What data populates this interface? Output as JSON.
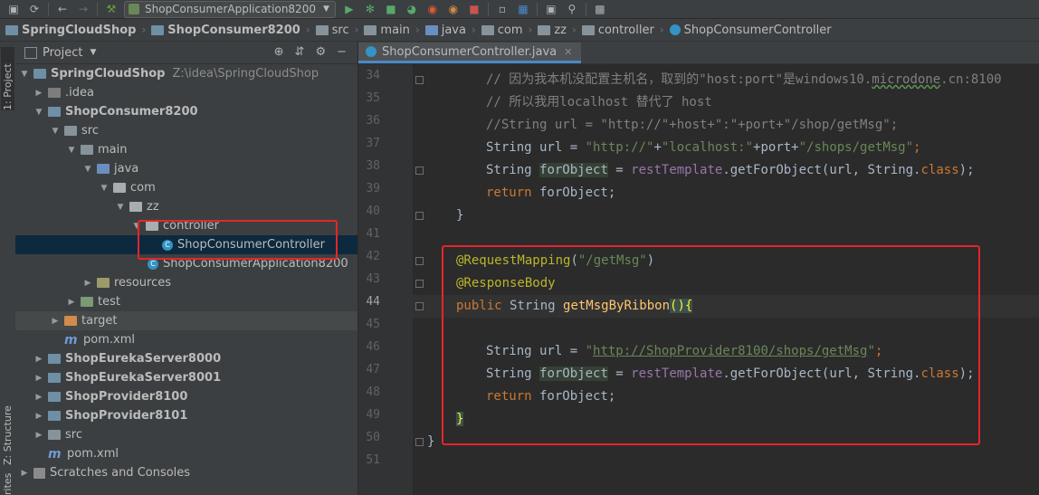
{
  "toolbar": {
    "icons": [
      "save-icon",
      "sync-icon",
      "back-icon",
      "forward-icon",
      "build-icon"
    ],
    "run_config_label": "ShopConsumerApplication8200",
    "run_icons": [
      "run-icon",
      "debug-icon",
      "coverage-icon",
      "profile-icon",
      "stop-icon",
      "vcs-icon",
      "structure-icon",
      "layout-icon",
      "search-icon",
      "plugin-icon"
    ]
  },
  "breadcrumb": [
    "SpringCloudShop",
    "ShopConsumer8200",
    "src",
    "main",
    "java",
    "com",
    "zz",
    "controller",
    "ShopConsumerController"
  ],
  "sidebar": {
    "project_tab": "1: Project",
    "structure_tab": "Z: Structure",
    "favorites_tab": "rites"
  },
  "project_panel": {
    "title": "Project",
    "tree": [
      {
        "label": "SpringCloudShop",
        "path": "Z:\\idea\\SpringCloudShop"
      },
      {
        "label": ".idea"
      },
      {
        "label": "ShopConsumer8200"
      },
      {
        "label": "src"
      },
      {
        "label": "main"
      },
      {
        "label": "java"
      },
      {
        "label": "com"
      },
      {
        "label": "zz"
      },
      {
        "label": "controller"
      },
      {
        "label": "ShopConsumerController"
      },
      {
        "label": "ShopConsumerApplication8200"
      },
      {
        "label": "resources"
      },
      {
        "label": "test"
      },
      {
        "label": "target"
      },
      {
        "label": "pom.xml"
      },
      {
        "label": "ShopEurekaServer8000"
      },
      {
        "label": "ShopEurekaServer8001"
      },
      {
        "label": "ShopProvider8100"
      },
      {
        "label": "ShopProvider8101"
      },
      {
        "label": "src"
      },
      {
        "label": "pom.xml"
      },
      {
        "label": "Scratches and Consoles"
      }
    ]
  },
  "editor": {
    "tab_label": "ShopConsumerController.java",
    "line_numbers": [
      "34",
      "35",
      "36",
      "37",
      "38",
      "39",
      "40",
      "41",
      "42",
      "43",
      "44",
      "45",
      "46",
      "47",
      "48",
      "49",
      "50",
      "51"
    ],
    "code": {
      "l34": "// 因为我本机没配置主机名，取到的\"host:port\"是windows10.",
      "l34b": "microdone",
      "l34c": ".cn:8100",
      "l35": "// 所以我用localhost 替代了 host",
      "l36": "//String url = \"http://\"+host+\":\"+port+\"/shop/getMsg\";",
      "l37a": "String url = ",
      "l37b": "\"http://\"",
      "l37c": "+",
      "l37d": "\"localhost:\"",
      "l37e": "+port+",
      "l37f": "\"/shops/getMsg\"",
      "l37g": ";",
      "l38a": "String ",
      "l38b": "forObject",
      "l38c": " = ",
      "l38d": "restTemplate",
      "l38e": ".getForObject(url, String.",
      "l38f": "class",
      "l38g": ");",
      "l39a": "return",
      "l39b": " forObject;",
      "l40": "}",
      "l42a": "@RequestMapping",
      "l42b": "(",
      "l42c": "\"/getMsg\"",
      "l42d": ")",
      "l43": "@ResponseBody",
      "l44a": "public",
      "l44b": " String ",
      "l44c": "getMsgByRibbon",
      "l44d": "(){",
      "l46a": "String url = ",
      "l46b": "\"",
      "l46c": "http://ShopProvider8100/shops/getMsg",
      "l46d": "\"",
      "l46e": ";",
      "l47a": "String ",
      "l47b": "forObject",
      "l47c": " = ",
      "l47d": "restTemplate",
      "l47e": ".getForObject(url, String.",
      "l47f": "class",
      "l47g": ");",
      "l48a": "return",
      "l48b": " forObject;",
      "l49": "}",
      "l50": "}"
    }
  },
  "colors": {
    "accent": "#4a88c7",
    "highlight_box": "#e5252a",
    "background": "#2b2b2b"
  }
}
